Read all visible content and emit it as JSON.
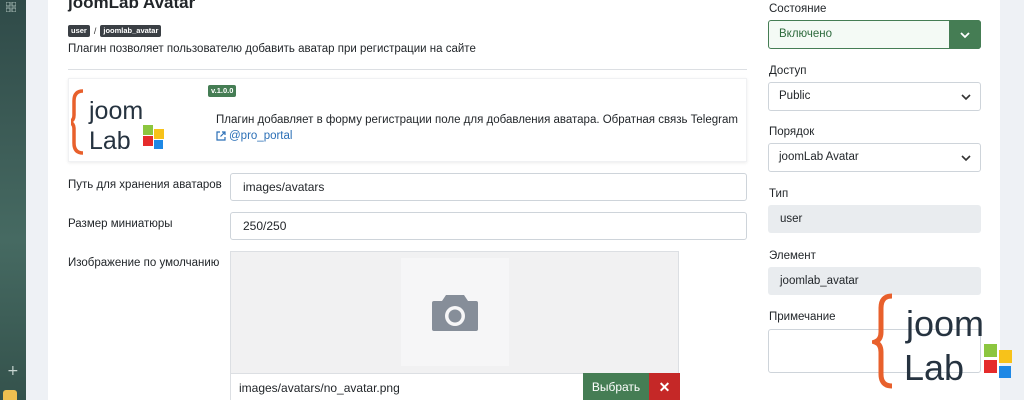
{
  "plugin": {
    "title": "joomLab Avatar",
    "badges": [
      "user",
      "joomlab_avatar"
    ],
    "badge_sep": "/",
    "description": "Плагин позволяет пользователю добавить аватар при регистрации на сайте",
    "version": "v.1.0.0",
    "info_text": "Плагин добавляет в форму регистрации поле для добавления аватара. Обратная связь Telegram",
    "link_text": "@pro_portal"
  },
  "logo": {
    "line1": "joom",
    "line2": "Lab",
    "colors": {
      "brace": "#e8602c",
      "green": "#8cc63f",
      "yellow": "#f7c21a",
      "red": "#e52b2b",
      "blue": "#1e88e5"
    }
  },
  "fields": {
    "avatar_path": {
      "label": "Путь для хранения аватаров",
      "value": "images/avatars"
    },
    "thumb_size": {
      "label": "Размер миниатюры",
      "value": "250/250"
    },
    "default_image": {
      "label": "Изображение по умолчанию",
      "value": "images/avatars/no_avatar.png",
      "select_label": "Выбрать",
      "clear_label": "✕"
    }
  },
  "sidebar": {
    "status": {
      "label": "Состояние",
      "value": "Включено"
    },
    "access": {
      "label": "Доступ",
      "value": "Public"
    },
    "order": {
      "label": "Порядок",
      "value": "joomLab Avatar"
    },
    "type": {
      "label": "Тип",
      "value": "user"
    },
    "element": {
      "label": "Элемент",
      "value": "joomlab_avatar"
    },
    "note": {
      "label": "Примечание",
      "value": ""
    }
  },
  "rail": {
    "plus": "+"
  },
  "colors": {
    "accent_green": "#457d54",
    "danger_red": "#c52827",
    "link_blue": "#2b6fb6"
  }
}
